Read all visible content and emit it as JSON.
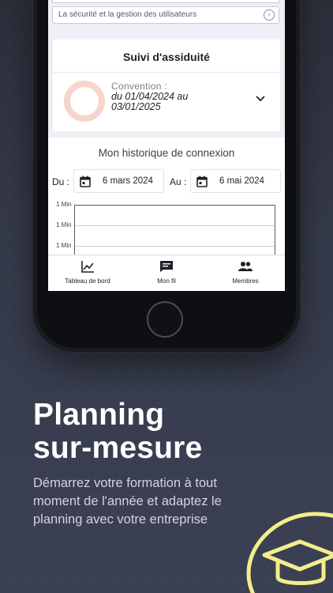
{
  "screen": {
    "security_row": {
      "label": "La sécurité et la gestion des utilisateurs"
    },
    "assiduity_card": {
      "title": "Suivi d'assiduité",
      "convention_label": "Convention :",
      "convention_dates_line1": "du 01/04/2024 au",
      "convention_dates_line2": "03/01/2025"
    },
    "history": {
      "title": "Mon historique de connexion",
      "from_label": "Du :",
      "from_value": "6 mars 2024",
      "to_label": "Au :",
      "to_value": "6 mai 2024",
      "y_ticks": [
        "1 Min",
        "1 Min",
        "1 Min"
      ]
    },
    "bottom_nav": [
      {
        "label": "Tableau de bord",
        "icon": "chart-line-icon"
      },
      {
        "label": "Mon fil",
        "icon": "chat-icon"
      },
      {
        "label": "Membres",
        "icon": "people-icon"
      }
    ]
  },
  "marketing": {
    "headline_line1": "Planning",
    "headline_line2": "sur-mesure",
    "subtitle": "Démarrez votre formation à tout moment de l'année et adaptez le planning avec votre entreprise"
  },
  "colors": {
    "accent_yellow": "#f3ee8a",
    "ring": "#f5d5cc",
    "subtitle": "#d7cfe9"
  }
}
